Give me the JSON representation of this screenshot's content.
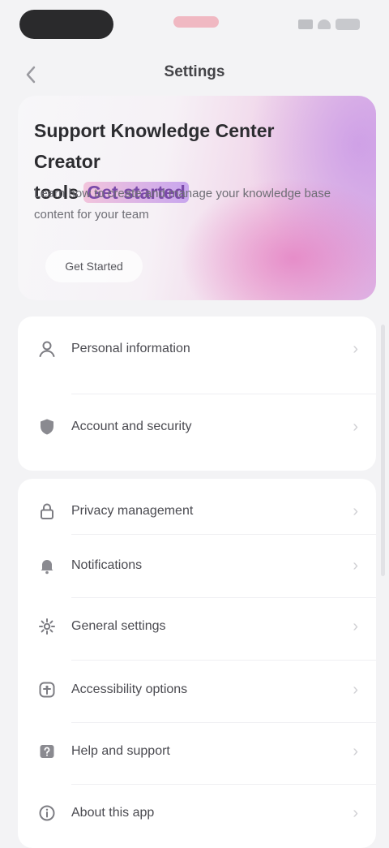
{
  "header": {
    "title": "Settings",
    "back_icon": "chevron-left-icon"
  },
  "banner": {
    "title_line1": "Support Knowledge Center Creator",
    "title_line2": "tools",
    "title_highlight": "Get started",
    "description": "Learn how to create and manage your knowledge base content for your team",
    "button_label": "Get Started",
    "colors": {
      "pink": "#e478be",
      "purple": "#c896e6"
    }
  },
  "group1": {
    "items": [
      {
        "label": "Personal information",
        "icon": "user-icon"
      },
      {
        "label": "Account and security",
        "icon": "shield-icon"
      }
    ]
  },
  "group2": {
    "items": [
      {
        "label": "Privacy management",
        "icon": "lock-icon"
      },
      {
        "label": "Notifications",
        "icon": "bell-icon"
      },
      {
        "label": "General settings",
        "icon": "gear-icon"
      },
      {
        "label": "Accessibility options",
        "icon": "accessibility-icon"
      },
      {
        "label": "Help and support",
        "icon": "help-icon"
      },
      {
        "label": "About this app",
        "icon": "info-icon"
      }
    ]
  }
}
